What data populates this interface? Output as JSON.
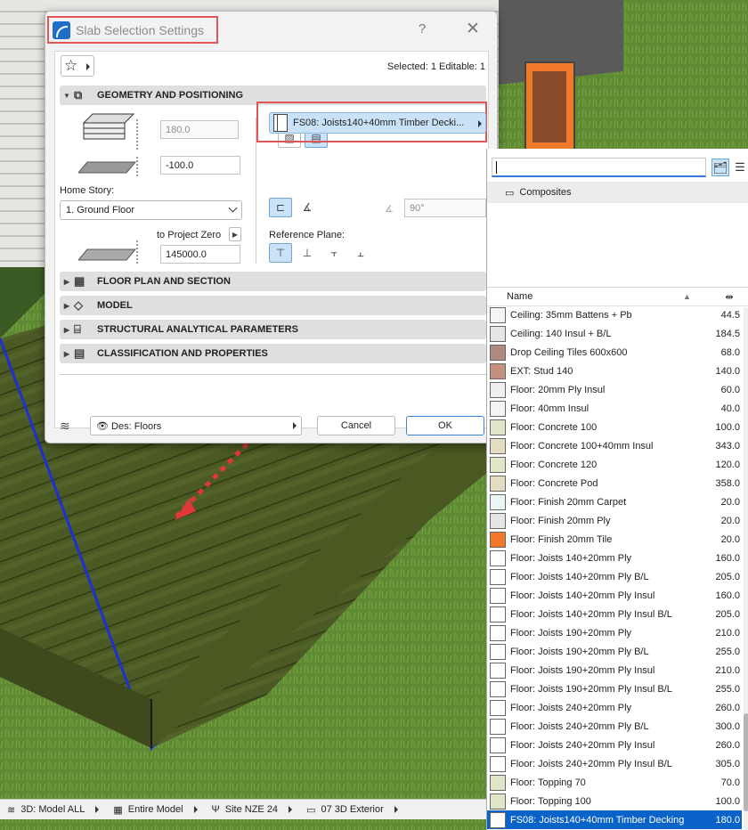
{
  "dialog": {
    "title": "Slab Selection Settings",
    "help_label": "?",
    "close_label": "✕",
    "selected_info": "Selected: 1 Editable: 1",
    "geometry": {
      "heading": "GEOMETRY AND POSITIONING",
      "thickness": "180.0",
      "offset": "-100.0",
      "home_story_label": "Home Story:",
      "home_story_value": "1. Ground Floor",
      "to_project_zero_label": "to Project Zero",
      "elevation": "145000.0",
      "composite": "FS08: Joists140+40mm Timber Decki...",
      "angle": "90°",
      "reference_plane_label": "Reference Plane:"
    },
    "panels": [
      "FLOOR PLAN AND SECTION",
      "MODEL",
      "STRUCTURAL ANALYTICAL PARAMETERS",
      "CLASSIFICATION AND PROPERTIES"
    ],
    "footer": {
      "layer": "Des: Floors",
      "cancel": "Cancel",
      "ok": "OK"
    }
  },
  "picker": {
    "search_value": "",
    "folder": "Composites",
    "columns": {
      "name": "Name",
      "thickness_icon": "⇹"
    },
    "items": [
      {
        "name": "Ceiling: 35mm Battens + Pb",
        "thickness": "44.5",
        "color": "#f4f4f4"
      },
      {
        "name": "Ceiling: 140 Insul + B/L",
        "thickness": "184.5",
        "color": "#e6e6e6"
      },
      {
        "name": "Drop Ceiling Tiles 600x600",
        "thickness": "68.0",
        "color": "#b08a80"
      },
      {
        "name": "EXT: Stud 140",
        "thickness": "140.0",
        "color": "#c49080"
      },
      {
        "name": "Floor: 20mm Ply Insul",
        "thickness": "60.0",
        "color": "#efefef"
      },
      {
        "name": "Floor: 40mm Insul",
        "thickness": "40.0",
        "color": "#f4f4f4"
      },
      {
        "name": "Floor: Concrete 100",
        "thickness": "100.0",
        "color": "#dfe6c8"
      },
      {
        "name": "Floor: Concrete 100+40mm Insul",
        "thickness": "343.0",
        "color": "#e4dcc0"
      },
      {
        "name": "Floor: Concrete 120",
        "thickness": "120.0",
        "color": "#dfe6c8"
      },
      {
        "name": "Floor: Concrete Pod",
        "thickness": "358.0",
        "color": "#e4dcc0"
      },
      {
        "name": "Floor: Finish 20mm Carpet",
        "thickness": "20.0",
        "color": "#eaf6f6"
      },
      {
        "name": "Floor: Finish 20mm Ply",
        "thickness": "20.0",
        "color": "#e6e6e6"
      },
      {
        "name": "Floor: Finish 20mm Tile",
        "thickness": "20.0",
        "color": "#f07a2a"
      },
      {
        "name": "Floor: Joists 140+20mm Ply",
        "thickness": "160.0",
        "color": "#ffffff"
      },
      {
        "name": "Floor: Joists 140+20mm Ply B/L",
        "thickness": "205.0",
        "color": "#ffffff"
      },
      {
        "name": "Floor: Joists 140+20mm Ply Insul",
        "thickness": "160.0",
        "color": "#ffffff"
      },
      {
        "name": "Floor: Joists 140+20mm Ply Insul B/L",
        "thickness": "205.0",
        "color": "#ffffff"
      },
      {
        "name": "Floor: Joists 190+20mm Ply",
        "thickness": "210.0",
        "color": "#ffffff"
      },
      {
        "name": "Floor: Joists 190+20mm Ply B/L",
        "thickness": "255.0",
        "color": "#ffffff"
      },
      {
        "name": "Floor: Joists 190+20mm Ply Insul",
        "thickness": "210.0",
        "color": "#ffffff"
      },
      {
        "name": "Floor: Joists 190+20mm Ply Insul B/L",
        "thickness": "255.0",
        "color": "#ffffff"
      },
      {
        "name": "Floor: Joists 240+20mm Ply",
        "thickness": "260.0",
        "color": "#ffffff"
      },
      {
        "name": "Floor: Joists 240+20mm Ply B/L",
        "thickness": "300.0",
        "color": "#ffffff"
      },
      {
        "name": "Floor: Joists 240+20mm Ply Insul",
        "thickness": "260.0",
        "color": "#ffffff"
      },
      {
        "name": "Floor: Joists 240+20mm Ply Insul B/L",
        "thickness": "305.0",
        "color": "#ffffff"
      },
      {
        "name": "Floor: Topping 70",
        "thickness": "70.0",
        "color": "#dfe6c8"
      },
      {
        "name": "Floor: Topping 100",
        "thickness": "100.0",
        "color": "#dfe6c8"
      },
      {
        "name": "FS08: Joists140+40mm Timber Decking",
        "thickness": "180.0",
        "color": "#ffffff",
        "selected": true
      }
    ]
  },
  "statusbar": {
    "items": [
      "3D: Model ALL",
      "Entire Model",
      "Site NZE 24",
      "07 3D Exterior"
    ]
  },
  "colors": {
    "accent": "#0a63c9",
    "highlight_box": "#e05555",
    "slab_edge": "#1f2fd0"
  }
}
